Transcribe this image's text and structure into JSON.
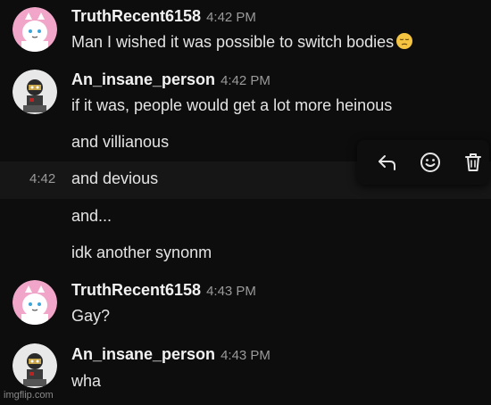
{
  "messages": [
    {
      "username": "TruthRecent6158",
      "time": "4:42 PM",
      "text": "Man I wished it was possible to switch bodies",
      "emoji": "pensive-face-icon"
    },
    {
      "username": "An_insane_person",
      "time": "4:42 PM",
      "lines": [
        "if it was, people would get a lot more heinous",
        "and villianous",
        "and devious",
        "and...",
        "idk another synonm"
      ],
      "hovered_line_time": "4:42"
    },
    {
      "username": "TruthRecent6158",
      "time": "4:43 PM",
      "text": "Gay?"
    },
    {
      "username": "An_insane_person",
      "time": "4:43 PM",
      "text": "wha"
    }
  ],
  "action_bar": {
    "icons": [
      "reply-icon",
      "add-reaction-icon",
      "delete-icon"
    ]
  },
  "colors": {
    "background": "#0d0d0d",
    "avatar_pink": "#f1a6c9",
    "avatar_white": "#e8e8e8"
  },
  "watermark": "imgflip.com"
}
